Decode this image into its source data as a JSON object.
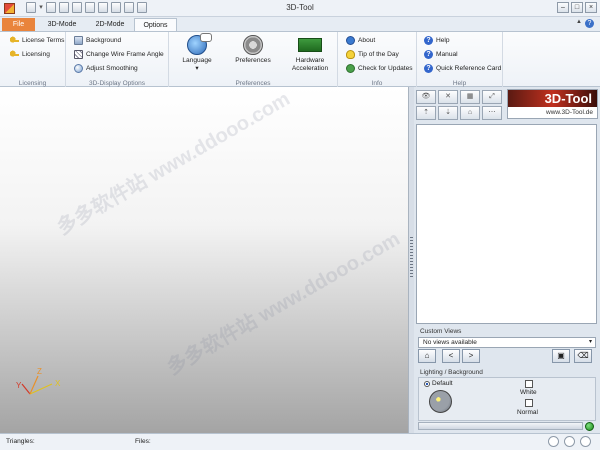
{
  "window": {
    "title": "3D-Tool"
  },
  "tabs": [
    {
      "label": "File"
    },
    {
      "label": "3D-Mode"
    },
    {
      "label": "2D-Mode"
    },
    {
      "label": "Options"
    }
  ],
  "ribbon": {
    "licensing": {
      "label": "Licensing",
      "items": [
        "License Terms",
        "Licensing"
      ]
    },
    "display": {
      "label": "3D-Display Options",
      "items": [
        "Background",
        "Change Wire Frame Angle",
        "Adjust Smoothing"
      ]
    },
    "preferences": {
      "label": "Preferences",
      "language": "Language",
      "prefs": "Preferences",
      "hw1": "Hardware",
      "hw2": "Acceleration"
    },
    "info": {
      "label": "Info",
      "items": [
        "About",
        "Tip of the Day",
        "Check for Updates"
      ]
    },
    "help": {
      "label": "Help",
      "items": [
        "Help",
        "Manual",
        "Quick Reference Card"
      ]
    }
  },
  "watermark": "多多软件站  www.ddooo.com",
  "axes": {
    "x": "X",
    "y": "Y",
    "z": "Z"
  },
  "panel": {
    "logo_text": "3D-Tool",
    "logo_url": "www.3D-Tool.de",
    "custom_views_label": "Custom Views",
    "views_value": "No views available",
    "lighting_label": "Lighting / Background",
    "default_label": "Default",
    "white_label": "White",
    "normal_label": "Normal"
  },
  "status": {
    "triangles": "Triangles:",
    "files": "Files:"
  },
  "icons": {
    "license": "key-icon",
    "wire": "wireframe-icon",
    "smooth": "smoothing-icon",
    "lang": "language-icon",
    "prefs": "gear-icon",
    "hw": "graphics-card-icon",
    "about": "globe-icon",
    "tip": "bulb-icon",
    "update": "update-icon",
    "help": "question-icon"
  },
  "colors": {
    "file_tab": "#e9843c",
    "logo_red": "#c0301f",
    "status_led": "#1b8a1b"
  }
}
